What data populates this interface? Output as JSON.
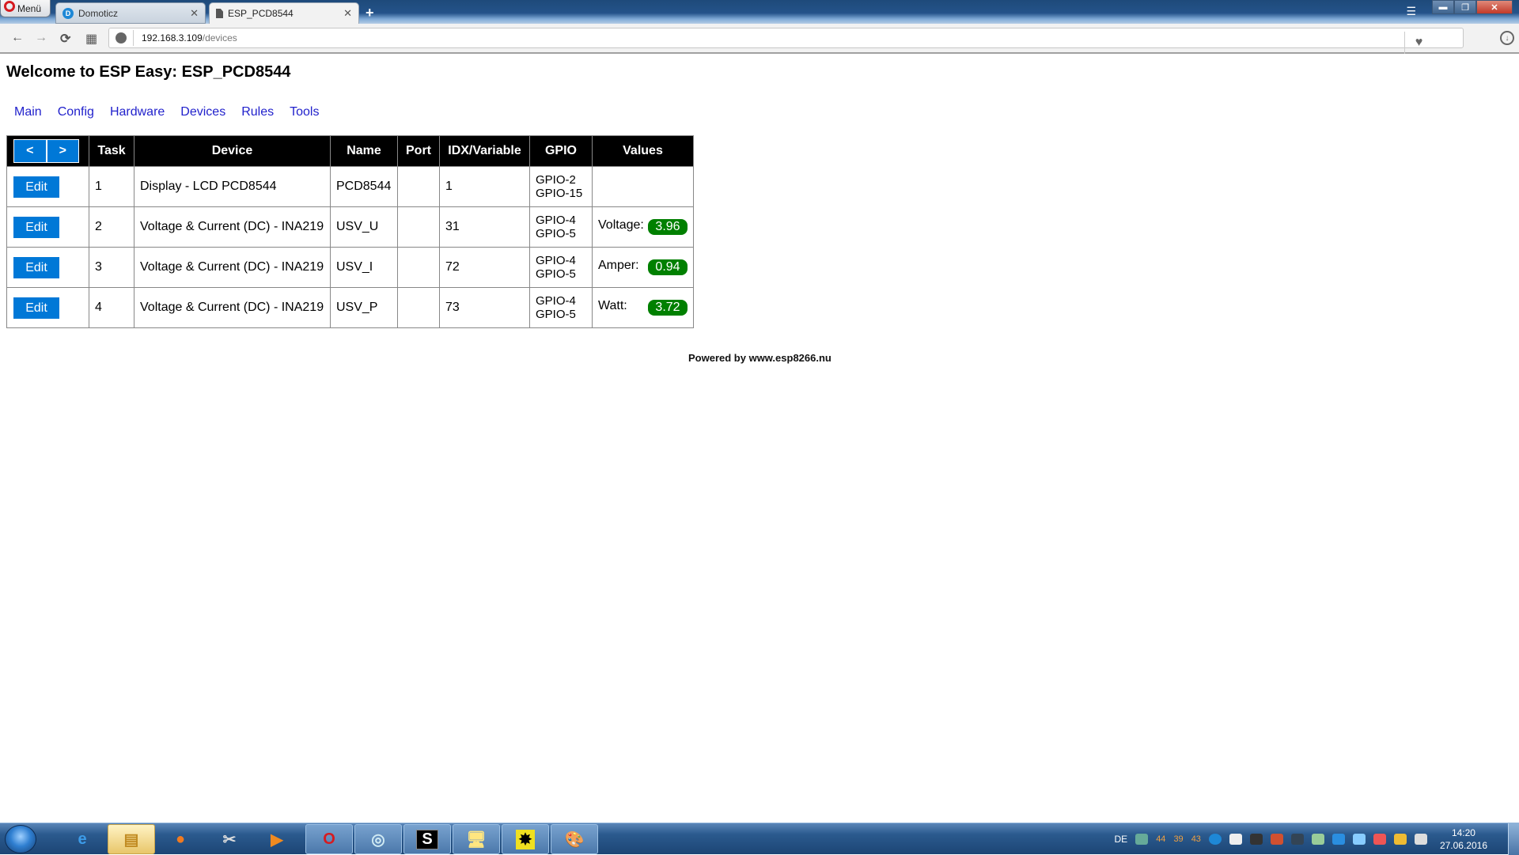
{
  "browser": {
    "menu_label": "Menü",
    "tabs": [
      {
        "title": "Domoticz",
        "icon": "domoticz-icon",
        "active": false
      },
      {
        "title": "ESP_PCD8544",
        "icon": "page-icon",
        "active": true
      }
    ],
    "new_tab_glyph": "+",
    "close_glyph": "✕",
    "url_host": "192.168.3.109",
    "url_path": "/devices",
    "nav": {
      "back": "←",
      "forward": "→",
      "reload": "⟳",
      "speed_dial": "▦"
    },
    "heart_glyph": "♥",
    "download_glyph": "↓"
  },
  "page": {
    "title": "Welcome to ESP Easy: ESP_PCD8544",
    "menu": [
      "Main",
      "Config",
      "Hardware",
      "Devices",
      "Rules",
      "Tools"
    ],
    "table": {
      "pager": {
        "prev": "<",
        "next": ">"
      },
      "headers": [
        "Task",
        "Device",
        "Name",
        "Port",
        "IDX/Variable",
        "GPIO",
        "Values"
      ],
      "edit_label": "Edit",
      "rows": [
        {
          "task": "1",
          "device": "Display - LCD PCD8544",
          "name": "PCD8544",
          "port": "",
          "idx": "1",
          "gpio": [
            "GPIO-2",
            "GPIO-15"
          ],
          "value_label": "",
          "value": ""
        },
        {
          "task": "2",
          "device": "Voltage & Current (DC) - INA219",
          "name": "USV_U",
          "port": "",
          "idx": "31",
          "gpio": [
            "GPIO-4",
            "GPIO-5"
          ],
          "value_label": "Voltage:",
          "value": "3.96"
        },
        {
          "task": "3",
          "device": "Voltage & Current (DC) - INA219",
          "name": "USV_I",
          "port": "",
          "idx": "72",
          "gpio": [
            "GPIO-4",
            "GPIO-5"
          ],
          "value_label": "Amper:",
          "value": "0.94"
        },
        {
          "task": "4",
          "device": "Voltage & Current (DC) - INA219",
          "name": "USV_P",
          "port": "",
          "idx": "73",
          "gpio": [
            "GPIO-4",
            "GPIO-5"
          ],
          "value_label": "Watt:",
          "value": "3.72"
        }
      ]
    },
    "footer": "Powered by www.esp8266.nu"
  },
  "colors": {
    "button_blue": "#0078d7",
    "value_badge_green": "#008000",
    "link_blue": "#2222cc",
    "header_bg": "#000000"
  },
  "taskbar": {
    "apps": [
      "internet-explorer",
      "file-explorer",
      "firefox",
      "snipping-tool",
      "media-player",
      "opera",
      "network-tool",
      "s-app",
      "remote-desktop",
      "yellow-app",
      "paint"
    ],
    "language": "DE",
    "tray_numbers": [
      "44",
      "39",
      "43"
    ],
    "time": "14:20",
    "date": "27.06.2016"
  }
}
